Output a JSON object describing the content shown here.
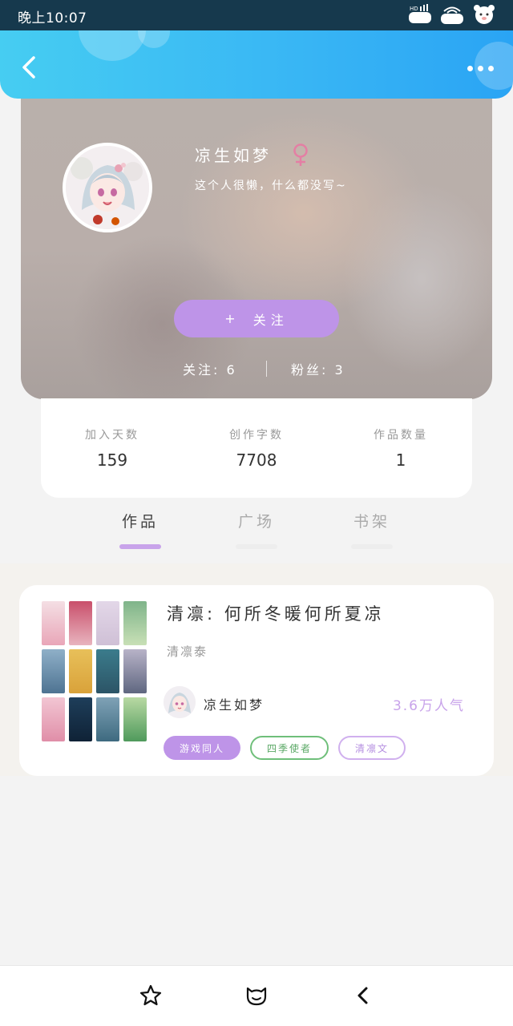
{
  "status_bar": {
    "time": "晚上10:07"
  },
  "profile": {
    "nickname": "凉生如梦",
    "gender_symbol": "♀",
    "bio": "这个人很懒，什么都没写~",
    "follow_button": {
      "plus": "+",
      "label": "关注"
    },
    "following": "关注: 6",
    "followers": "粉丝: 3"
  },
  "stats": [
    {
      "label": "加入天数",
      "value": "159"
    },
    {
      "label": "创作字数",
      "value": "7708"
    },
    {
      "label": "作品数量",
      "value": "1"
    }
  ],
  "tabs": [
    {
      "label": "作品",
      "active": true
    },
    {
      "label": "广场",
      "active": false
    },
    {
      "label": "书架",
      "active": false
    }
  ],
  "work": {
    "title": "清凛: 何所冬暖何所夏凉",
    "subtitle": "清凛泰",
    "author": "凉生如梦",
    "popularity": "3.6万人气",
    "tags": [
      "游戏同人",
      "四季使者",
      "清凛文"
    ]
  },
  "colors": {
    "accent_purple": "#be94e8",
    "header_blue": "#38b5f4",
    "tag_green": "#6fbf7a"
  },
  "icons": {
    "back": "chevron-left-icon",
    "more": "more-dots-icon",
    "nav_star": "star-icon",
    "nav_face": "cat-face-icon",
    "nav_back": "chevron-left-icon"
  }
}
